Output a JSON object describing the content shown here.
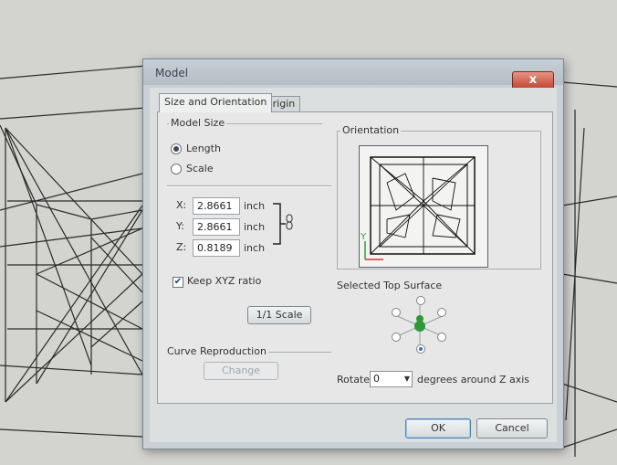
{
  "dialog": {
    "title": "Model",
    "close_label": "x",
    "tabs": [
      {
        "label": "Size and Orientation",
        "active": true
      },
      {
        "label": "Origin",
        "active": false
      }
    ]
  },
  "model_size": {
    "title": "Model Size",
    "options": [
      {
        "label": "Length",
        "selected": true
      },
      {
        "label": "Scale",
        "selected": false
      }
    ],
    "fields": [
      {
        "axis": "X:",
        "value": "2.8661",
        "unit": "inch"
      },
      {
        "axis": "Y:",
        "value": "2.8661",
        "unit": "inch"
      },
      {
        "axis": "Z:",
        "value": "0.8189",
        "unit": "inch"
      }
    ],
    "keep_ratio_label": "Keep XYZ ratio",
    "keep_ratio_checked": true,
    "scale_button": "1/1 Scale"
  },
  "curve": {
    "title": "Curve Reproduction",
    "change_button": "Change"
  },
  "orientation": {
    "title": "Orientation",
    "axis_y": "Y",
    "selected_surface_title": "Selected Top Surface",
    "rotate_label": "Rotate",
    "rotate_value": "0",
    "rotate_suffix": "degrees around Z axis"
  },
  "footer": {
    "ok": "OK",
    "cancel": "Cancel"
  },
  "colors": {
    "close_red": "#c2452f",
    "surface_selected": "#2e9a34",
    "axis_red": "#d9352b",
    "axis_green": "#2f9a3a"
  }
}
